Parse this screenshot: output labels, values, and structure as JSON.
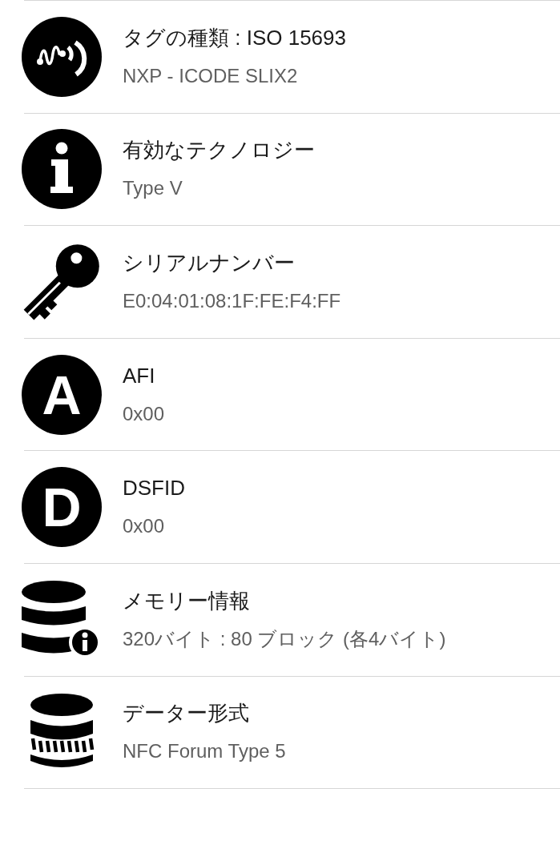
{
  "rows": [
    {
      "kind": "wave",
      "title": "タグの種類 : ISO 15693",
      "value": "NXP - ICODE SLIX2"
    },
    {
      "kind": "info",
      "title": "有効なテクノロジー",
      "value": "Type V"
    },
    {
      "kind": "key",
      "title": "シリアルナンバー",
      "value": "E0:04:01:08:1F:FE:F4:FF"
    },
    {
      "kind": "letter",
      "letter": "A",
      "title": "AFI",
      "value": "0x00"
    },
    {
      "kind": "letter",
      "letter": "D",
      "title": "DSFID",
      "value": "0x00"
    },
    {
      "kind": "database-info",
      "title": "メモリー情報",
      "value": "320バイト : 80 ブロック (各4バイト)"
    },
    {
      "kind": "database-stripes",
      "title": "データー形式",
      "value": "NFC Forum Type 5"
    }
  ]
}
